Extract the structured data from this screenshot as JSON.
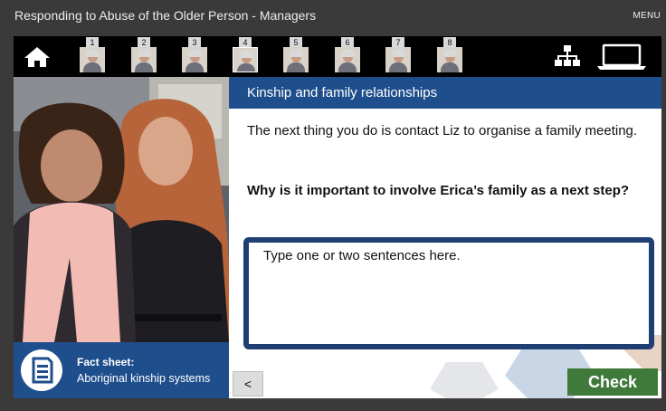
{
  "window": {
    "title": "Responding to Abuse of the Older Person - Managers",
    "menu_label": "MENU"
  },
  "nav": {
    "home_icon": "home-icon",
    "scenarios": [
      {
        "label": "1",
        "active": false
      },
      {
        "label": "2",
        "active": false
      },
      {
        "label": "3",
        "active": false
      },
      {
        "label": "4",
        "active": true
      },
      {
        "label": "5",
        "active": false
      },
      {
        "label": "6",
        "active": false
      },
      {
        "label": "7",
        "active": false
      },
      {
        "label": "8",
        "active": false
      }
    ],
    "progress": {
      "label": "9",
      "fraction": 0.5
    },
    "sitemap_icon": "sitemap-icon",
    "laptop_icon": "laptop-icon"
  },
  "fact_sheet": {
    "title": "Fact sheet:",
    "subtitle": "Aboriginal kinship systems",
    "icon": "document-icon"
  },
  "panel": {
    "heading": "Kinship and family relationships",
    "intro": "The next thing you do is contact Liz to organise a family meeting.",
    "question": "Why is it important to involve Erica’s family as a next step?",
    "answer_placeholder": "Type one or two sentences here.",
    "answer_value": ""
  },
  "buttons": {
    "back_label": "<",
    "check_label": "Check"
  },
  "colors": {
    "brand_blue": "#1f4e8c",
    "answer_border": "#1f3f73",
    "check_green": "#3f7a3b",
    "progress_green": "#7fc04a"
  }
}
